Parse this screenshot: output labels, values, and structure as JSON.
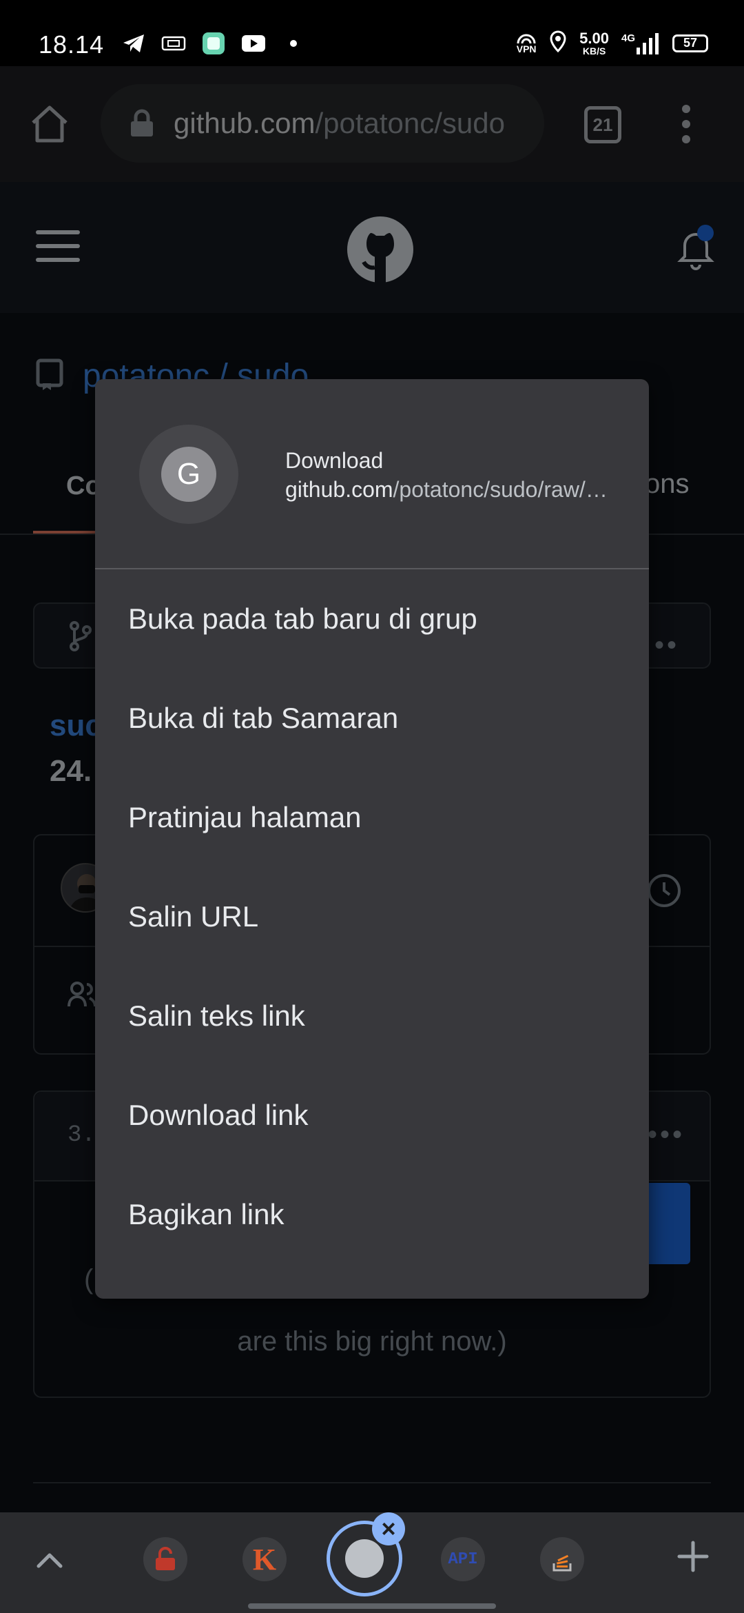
{
  "status_bar": {
    "time": "18.14",
    "speed_value": "5.00",
    "speed_unit": "KB/S",
    "network": "4G",
    "vpn_label": "VPN",
    "battery": "57"
  },
  "browser": {
    "url_host": "github.com",
    "url_path": "/potatonc/sudo",
    "tab_count": "21"
  },
  "page": {
    "repo_owner": "potatonc / sudo",
    "tab_left": "Co",
    "tab_right": "ons",
    "file_title": "suc",
    "file_size": "24.",
    "lines": "3.",
    "blob_message_left": "(",
    "blob_message": "are this big right now.)"
  },
  "context_menu": {
    "favicon_letter": "G",
    "title": "Download",
    "url_host": "github.com",
    "url_path": "/potatonc/sudo/raw/…",
    "items": [
      {
        "label": "Buka pada tab baru di grup"
      },
      {
        "label": "Buka di tab Samaran"
      },
      {
        "label": "Pratinjau halaman"
      },
      {
        "label": "Salin URL"
      },
      {
        "label": "Salin teks link"
      },
      {
        "label": "Download link"
      },
      {
        "label": "Bagikan link"
      }
    ]
  },
  "bottom_bar": {
    "group_tabs": [
      {
        "icon": "unlock-icon",
        "color": "#c0392b"
      },
      {
        "icon": "k-icon",
        "label": "K",
        "color": "#e0592a"
      },
      {
        "icon": "api-icon",
        "label": "API",
        "color": "#2f4cb3"
      },
      {
        "icon": "stackoverflow-icon",
        "color": "#f48024"
      }
    ],
    "close_symbol": "×"
  },
  "colors": {
    "accent_blue": "#4493f8",
    "menu_bg": "#38383c",
    "page_bg": "#0d1117"
  }
}
